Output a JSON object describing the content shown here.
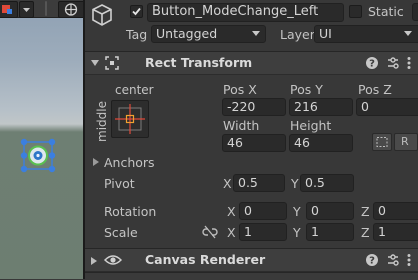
{
  "object": {
    "name": "Button_ModeChange_Left",
    "active": true,
    "static_label": "Static",
    "static_checked": false,
    "tag_label": "Tag",
    "tag_value": "Untagged",
    "layer_label": "Layer",
    "layer_value": "UI"
  },
  "rect_transform": {
    "title": "Rect Transform",
    "anchor_h": "center",
    "anchor_v": "middle",
    "pos_x_label": "Pos X",
    "pos_y_label": "Pos Y",
    "pos_z_label": "Pos Z",
    "pos_x": "-220",
    "pos_y": "216",
    "pos_z": "0",
    "width_label": "Width",
    "height_label": "Height",
    "width": "46",
    "height": "46",
    "raw_button_label": "R",
    "anchors_label": "Anchors",
    "pivot_label": "Pivot",
    "pivot_x_label": "X",
    "pivot_x": "0.5",
    "pivot_y_label": "Y",
    "pivot_y": "0.5",
    "rotation_label": "Rotation",
    "rot_x_label": "X",
    "rot_x": "0",
    "rot_y_label": "Y",
    "rot_y": "0",
    "rot_z_label": "Z",
    "rot_z": "0",
    "scale_label": "Scale",
    "scale_x_label": "X",
    "scale_x": "1",
    "scale_y_label": "Y",
    "scale_y": "1",
    "scale_z_label": "Z",
    "scale_z": "1"
  },
  "canvas_renderer": {
    "title": "Canvas Renderer"
  },
  "colors": {
    "panel": "#383838",
    "field": "#2a2a2a",
    "anchor_red": "#e04a3a",
    "anchor_orange": "#f0a030",
    "selection_blue": "#3b7fe0",
    "selection_green": "#59c050"
  },
  "icons": [
    "gameobject-cube-icon",
    "rect-transform-icon",
    "help-icon",
    "preset-icon",
    "kebab-menu-icon",
    "eye-icon",
    "link-scale-icon",
    "blueprint-mode-icon"
  ]
}
